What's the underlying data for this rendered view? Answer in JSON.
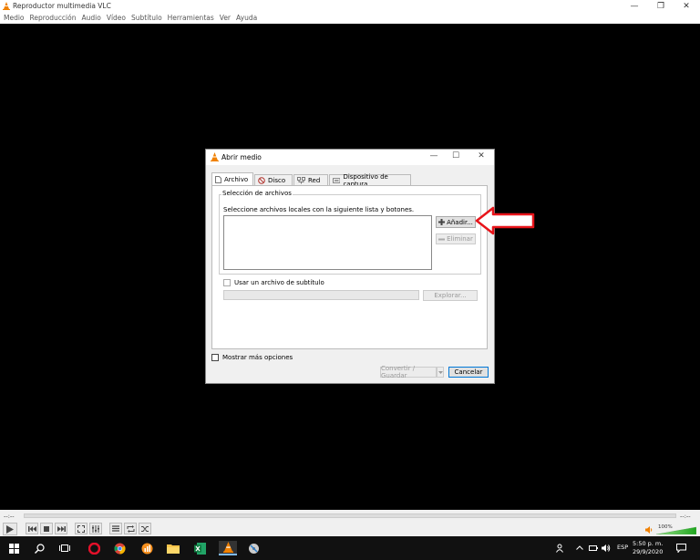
{
  "window": {
    "title": "Reproductor multimedia VLC",
    "controls": {
      "minimize": "—",
      "maximize": "❐",
      "close": "✕"
    }
  },
  "menu": [
    "Medio",
    "Reproducción",
    "Audio",
    "Vídeo",
    "Subtítulo",
    "Herramientas",
    "Ver",
    "Ayuda"
  ],
  "dialog": {
    "title": "Abrir medio",
    "controls": {
      "minimize": "—",
      "maximize": "☐",
      "close": "✕"
    },
    "tabs": [
      {
        "label": "Archivo",
        "icon": "file-icon",
        "active": true
      },
      {
        "label": "Disco",
        "icon": "disc-icon"
      },
      {
        "label": "Red",
        "icon": "network-icon"
      },
      {
        "label": "Dispositivo de captura",
        "icon": "capture-device-icon"
      }
    ],
    "file_group": {
      "label": "Selección de archivos",
      "hint": "Seleccione archivos locales con la siguiente lista y botones.",
      "add_button": "Añadir...",
      "remove_button": "Eliminar"
    },
    "subtitle": {
      "checkbox_label": "Usar un archivo de subtítulo",
      "browse_button": "Explorar..."
    },
    "more_options": "Mostrar más opciones",
    "convert_button": "Convertir / Guardar",
    "cancel_button": "Cancelar"
  },
  "player": {
    "time_elapsed": "--:--",
    "time_total": "--:--",
    "volume": "100%"
  },
  "taskbar": {
    "language": "ESP",
    "time": "5:50 p. m.",
    "date": "29/9/2020"
  },
  "colors": {
    "vlc_orange": "#f08000",
    "annotation_red": "#e8141a",
    "accent_blue": "#0078d7"
  }
}
